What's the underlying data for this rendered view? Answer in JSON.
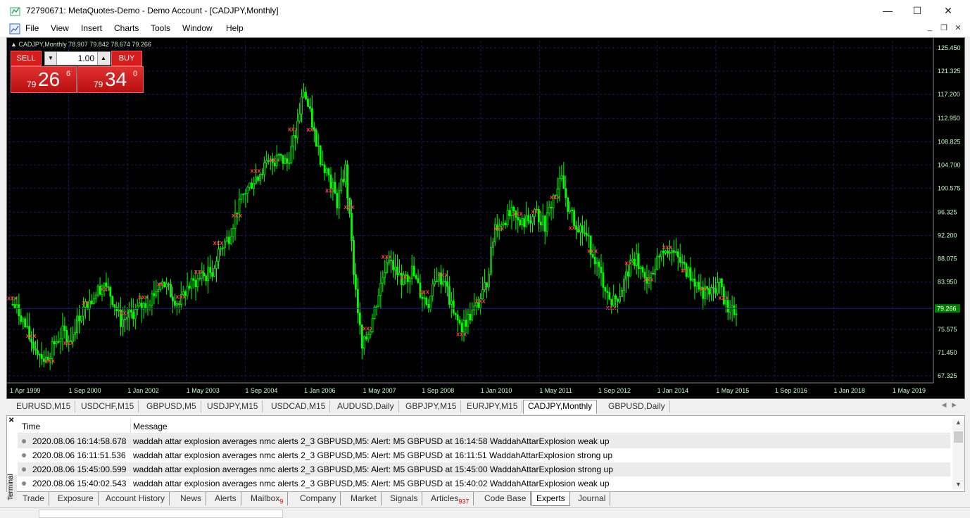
{
  "window": {
    "title": "72790671: MetaQuotes-Demo - Demo Account - [CADJPY,Monthly]",
    "minimize": "—",
    "maximize": "☐",
    "close": "✕"
  },
  "menu": [
    "File",
    "View",
    "Insert",
    "Charts",
    "Tools",
    "Window",
    "Help"
  ],
  "chart": {
    "header": "▲ CADJPY,Monthly  78.907 79.842 78.674 79.266",
    "one_click": {
      "sell_label": "SELL",
      "buy_label": "BUY",
      "lot": "1.00",
      "sell_small": "79",
      "sell_big": "26",
      "sell_sup": "6",
      "buy_small": "79",
      "buy_big": "34",
      "buy_sup": "0"
    },
    "current_price": "79.266",
    "colors": {
      "background": "#000000",
      "grid": "#1a1a6a",
      "bull": "#00ff00",
      "bear": "#00ff00",
      "text": "#c8ffc8",
      "price_label_bg": "#008000",
      "marker_red": "#ff4040"
    }
  },
  "chart_data": {
    "type": "candlestick",
    "symbol": "CADJPY",
    "timeframe": "Monthly",
    "x_ticks": [
      "1 Apr 1999",
      "1 Sep 2000",
      "1 Jan 2002",
      "1 May 2003",
      "1 Sep 2004",
      "1 Jan 2006",
      "1 May 2007",
      "1 Sep 2008",
      "1 Jan 2010",
      "1 May 2011",
      "1 Sep 2012",
      "1 Jan 2014",
      "1 May 2015",
      "1 Sep 2016",
      "1 Jan 2018",
      "1 May 2019"
    ],
    "y_ticks": [
      "125.450",
      "121.325",
      "117.200",
      "112.950",
      "108.825",
      "104.700",
      "100.575",
      "96.325",
      "92.200",
      "88.075",
      "83.950",
      "79.266",
      "75.575",
      "71.450",
      "67.325"
    ],
    "ylim": [
      67.325,
      125.45
    ],
    "close_series": [
      80,
      78,
      74,
      72,
      70,
      73,
      75,
      74,
      78,
      80,
      82,
      84,
      81,
      77,
      78,
      79,
      80,
      82,
      84,
      82,
      80,
      83,
      84,
      85,
      86,
      90,
      92,
      97,
      100,
      102,
      104,
      105,
      106,
      105,
      110,
      118,
      112,
      106,
      103,
      98,
      104,
      86,
      72,
      76,
      82,
      88,
      86,
      84,
      86,
      82,
      80,
      85,
      84,
      78,
      76,
      78,
      80,
      84,
      94,
      95,
      96,
      94,
      95,
      96,
      94,
      99,
      102,
      96,
      94,
      92,
      88,
      84,
      80,
      82,
      86,
      88,
      84,
      86,
      90,
      90,
      88,
      86,
      84,
      82,
      82,
      84,
      78,
      79.266
    ]
  },
  "chart_tabs": [
    {
      "label": "EURUSD,M15",
      "active": false
    },
    {
      "label": "USDCHF,M15",
      "active": false
    },
    {
      "label": "GBPUSD,M5",
      "active": false
    },
    {
      "label": "USDJPY,M15",
      "active": false
    },
    {
      "label": "USDCAD,M15",
      "active": false
    },
    {
      "label": "AUDUSD,Daily",
      "active": false
    },
    {
      "label": "GBPJPY,M15",
      "active": false
    },
    {
      "label": "EURJPY,M15",
      "active": false
    },
    {
      "label": "CADJPY,Monthly",
      "active": true
    },
    {
      "label": "GBPUSD,Daily",
      "active": false
    }
  ],
  "terminal": {
    "side_label": "Terminal",
    "columns": [
      "Time",
      "Message"
    ],
    "rows": [
      {
        "time": "2020.08.06 16:14:58.678",
        "message": "waddah attar explosion averages nmc alerts 2_3 GBPUSD,M5: Alert: M5 GBPUSD at 16:14:58 WaddahAttarExplosion  weak up"
      },
      {
        "time": "2020.08.06 16:11:51.536",
        "message": "waddah attar explosion averages nmc alerts 2_3 GBPUSD,M5: Alert: M5 GBPUSD at 16:11:51 WaddahAttarExplosion  strong up"
      },
      {
        "time": "2020.08.06 15:45:00.599",
        "message": "waddah attar explosion averages nmc alerts 2_3 GBPUSD,M5: Alert: M5 GBPUSD at 15:45:00 WaddahAttarExplosion  strong up"
      },
      {
        "time": "2020.08.06 15:40:02.543",
        "message": "waddah attar explosion averages nmc alerts 2_3 GBPUSD,M5: Alert: M5 GBPUSD at 15:40:02 WaddahAttarExplosion  weak up"
      }
    ]
  },
  "bottom_tabs": [
    {
      "label": "Trade",
      "badge": ""
    },
    {
      "label": "Exposure",
      "badge": ""
    },
    {
      "label": "Account History",
      "badge": ""
    },
    {
      "label": "News",
      "badge": ""
    },
    {
      "label": "Alerts",
      "badge": ""
    },
    {
      "label": "Mailbox",
      "badge": "9"
    },
    {
      "label": "Company",
      "badge": ""
    },
    {
      "label": "Market",
      "badge": ""
    },
    {
      "label": "Signals",
      "badge": ""
    },
    {
      "label": "Articles",
      "badge": "937"
    },
    {
      "label": "Code Base",
      "badge": ""
    },
    {
      "label": "Experts",
      "badge": "",
      "active": true
    },
    {
      "label": "Journal",
      "badge": ""
    }
  ]
}
